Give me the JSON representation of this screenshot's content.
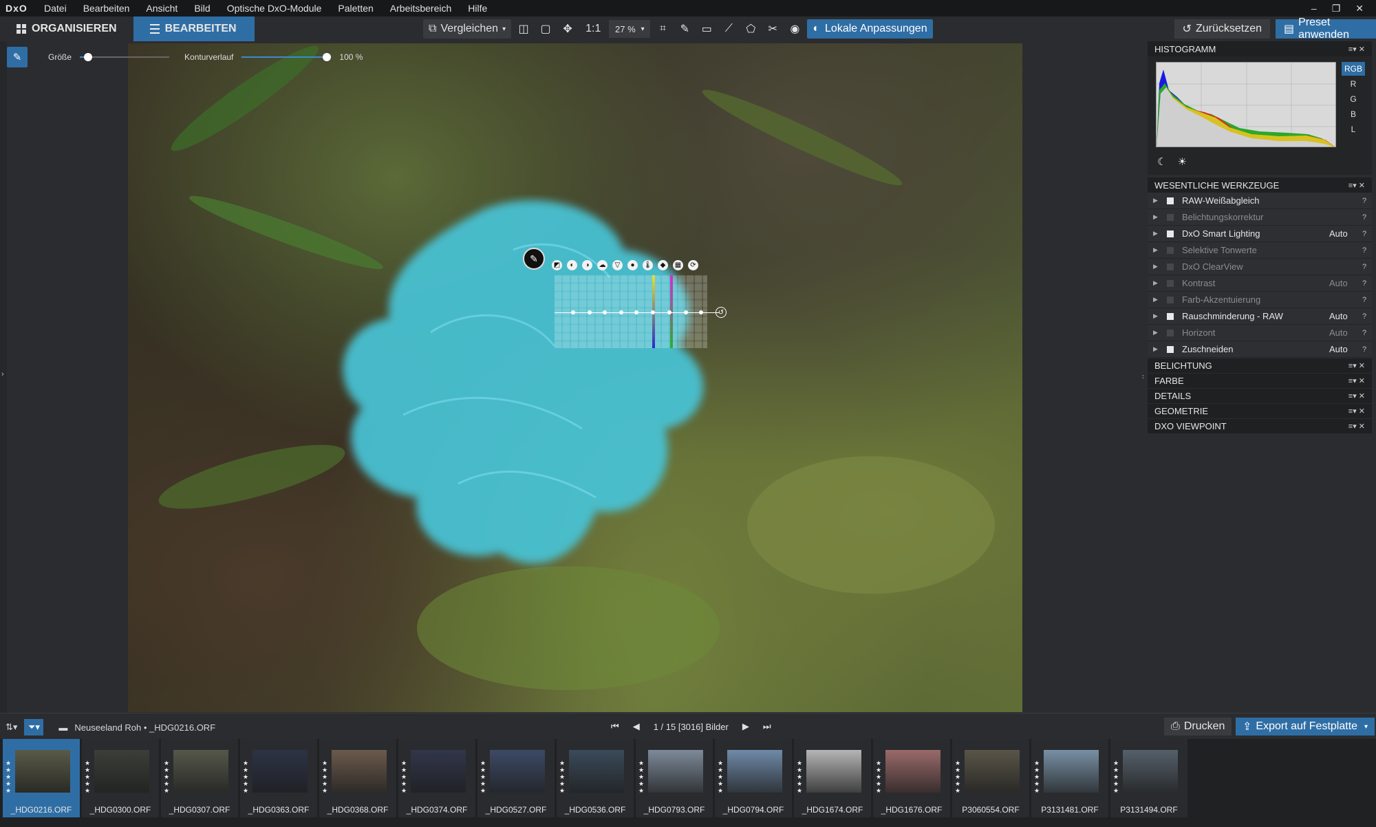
{
  "app": {
    "logo": "DxO",
    "menu": [
      "Datei",
      "Bearbeiten",
      "Ansicht",
      "Bild",
      "Optische DxO-Module",
      "Paletten",
      "Arbeitsbereich",
      "Hilfe"
    ],
    "window_controls": [
      "–",
      "❐",
      "✕"
    ]
  },
  "toolbar": {
    "tab_organize": "ORGANISIEREN",
    "tab_edit": "BEARBEITEN",
    "compare_label": "Vergleichen",
    "one_to_one": "1:1",
    "zoom": "27 %",
    "local_adjust": "Lokale Anpassungen",
    "reset": "Zurücksetzen",
    "apply_preset": "Preset anwenden"
  },
  "brush_tool": {
    "size_label": "Größe",
    "size_value": 0.05,
    "feather_label": "Konturverlauf",
    "feather_value": "100 %"
  },
  "histogram": {
    "title": "HISTOGRAMM",
    "channels": [
      "RGB",
      "R",
      "G",
      "B",
      "L"
    ],
    "active_channel": "RGB"
  },
  "essential_tools": {
    "title": "WESENTLICHE WERKZEUGE",
    "items": [
      {
        "label": "RAW-Weißabgleich",
        "enabled": true,
        "auto": ""
      },
      {
        "label": "Belichtungskorrektur",
        "enabled": false,
        "auto": ""
      },
      {
        "label": "DxO Smart Lighting",
        "enabled": true,
        "auto": "Auto"
      },
      {
        "label": "Selektive Tonwerte",
        "enabled": false,
        "auto": ""
      },
      {
        "label": "DxO ClearView",
        "enabled": false,
        "auto": ""
      },
      {
        "label": "Kontrast",
        "enabled": false,
        "auto": "Auto"
      },
      {
        "label": "Farb-Akzentuierung",
        "enabled": false,
        "auto": ""
      },
      {
        "label": "Rauschminderung - RAW",
        "enabled": true,
        "auto": "Auto"
      },
      {
        "label": "Horizont",
        "enabled": false,
        "auto": "Auto"
      },
      {
        "label": "Zuschneiden",
        "enabled": true,
        "auto": "Auto"
      }
    ]
  },
  "sections": [
    "BELICHTUNG",
    "FARBE",
    "DETAILS",
    "GEOMETRIE",
    "DXO VIEWPOINT"
  ],
  "film_bar": {
    "path": "Neuseeland Roh • _HDG0216.ORF",
    "counter": "1 / 15 [3016] Bilder",
    "print": "Drucken",
    "export": "Export auf Festplatte"
  },
  "thumbnails": [
    {
      "name": "_HDG0216.ORF",
      "selected": true,
      "tone": "#5a5a48"
    },
    {
      "name": "_HDG0300.ORF",
      "selected": false,
      "tone": "#3b3f38"
    },
    {
      "name": "_HDG0307.ORF",
      "selected": false,
      "tone": "#55574a"
    },
    {
      "name": "_HDG0363.ORF",
      "selected": false,
      "tone": "#2d3346"
    },
    {
      "name": "_HDG0368.ORF",
      "selected": false,
      "tone": "#6b5a4c"
    },
    {
      "name": "_HDG0374.ORF",
      "selected": false,
      "tone": "#31364a"
    },
    {
      "name": "_HDG0527.ORF",
      "selected": false,
      "tone": "#3d4a66"
    },
    {
      "name": "_HDG0536.ORF",
      "selected": false,
      "tone": "#3b4a5a"
    },
    {
      "name": "_HDG0793.ORF",
      "selected": false,
      "tone": "#7d8a99"
    },
    {
      "name": "_HDG0794.ORF",
      "selected": false,
      "tone": "#6f8aa8"
    },
    {
      "name": "_HDG1674.ORF",
      "selected": false,
      "tone": "#b5b5b5"
    },
    {
      "name": "_HDG1676.ORF",
      "selected": false,
      "tone": "#9a6a6a"
    },
    {
      "name": "P3060554.ORF",
      "selected": false,
      "tone": "#5a5548"
    },
    {
      "name": "P3131481.ORF",
      "selected": false,
      "tone": "#7890a5"
    },
    {
      "name": "P3131494.ORF",
      "selected": false,
      "tone": "#55606a"
    }
  ],
  "colors": {
    "accent": "#2f6ea5",
    "mask": "#47c3d6"
  }
}
